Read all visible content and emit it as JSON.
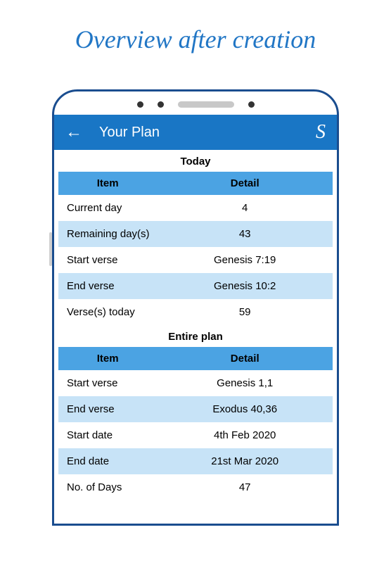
{
  "page_title": "Overview after creation",
  "app_bar": {
    "title": "Your Plan",
    "icon_letter": "S"
  },
  "sections": {
    "today": {
      "title": "Today",
      "headers": {
        "item": "Item",
        "detail": "Detail"
      },
      "rows": [
        {
          "item": "Current day",
          "detail": "4"
        },
        {
          "item": "Remaining day(s)",
          "detail": "43"
        },
        {
          "item": "Start verse",
          "detail": "Genesis 7:19"
        },
        {
          "item": "End verse",
          "detail": "Genesis 10:2"
        },
        {
          "item": "Verse(s) today",
          "detail": "59"
        }
      ]
    },
    "entire_plan": {
      "title": "Entire plan",
      "headers": {
        "item": "Item",
        "detail": "Detail"
      },
      "rows": [
        {
          "item": "Start verse",
          "detail": "Genesis 1,1"
        },
        {
          "item": "End verse",
          "detail": "Exodus 40,36"
        },
        {
          "item": "Start date",
          "detail": "4th Feb 2020"
        },
        {
          "item": "End date",
          "detail": "21st Mar 2020"
        },
        {
          "item": "No. of Days",
          "detail": "47"
        }
      ]
    }
  }
}
